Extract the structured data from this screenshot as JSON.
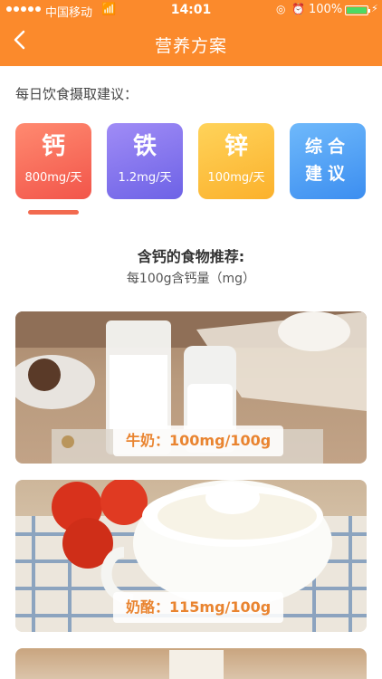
{
  "status_bar": {
    "carrier": "中国移动",
    "time": "14:01",
    "battery": "100%",
    "battery_level": 1.0
  },
  "nav": {
    "back_icon": "chevron-left-icon",
    "title": "营养方案"
  },
  "section_label": "每日饮食摄取建议：",
  "tabs": [
    {
      "name": "钙",
      "value": "800mg/天",
      "color": "#f2554a"
    },
    {
      "name": "铁",
      "value": "1.2mg/天",
      "color": "#6d62e6"
    },
    {
      "name": "锌",
      "value": "100mg/天",
      "color": "#fbb12c"
    },
    {
      "name": "综合建议",
      "line1": "综合",
      "line2": "建议",
      "color": "#3c8ef0"
    }
  ],
  "selected_tab": "钙",
  "recommendation": {
    "title": "含钙的食物推荐:",
    "subtitle": "每100g含钙量（mg）"
  },
  "foods": [
    {
      "label": "牛奶：100mg/100g"
    },
    {
      "label": "奶酪：115mg/100g"
    }
  ],
  "colors": {
    "accent": "#fb8a2c",
    "label_text": "#e98430",
    "indicator": "#f26a4f"
  }
}
